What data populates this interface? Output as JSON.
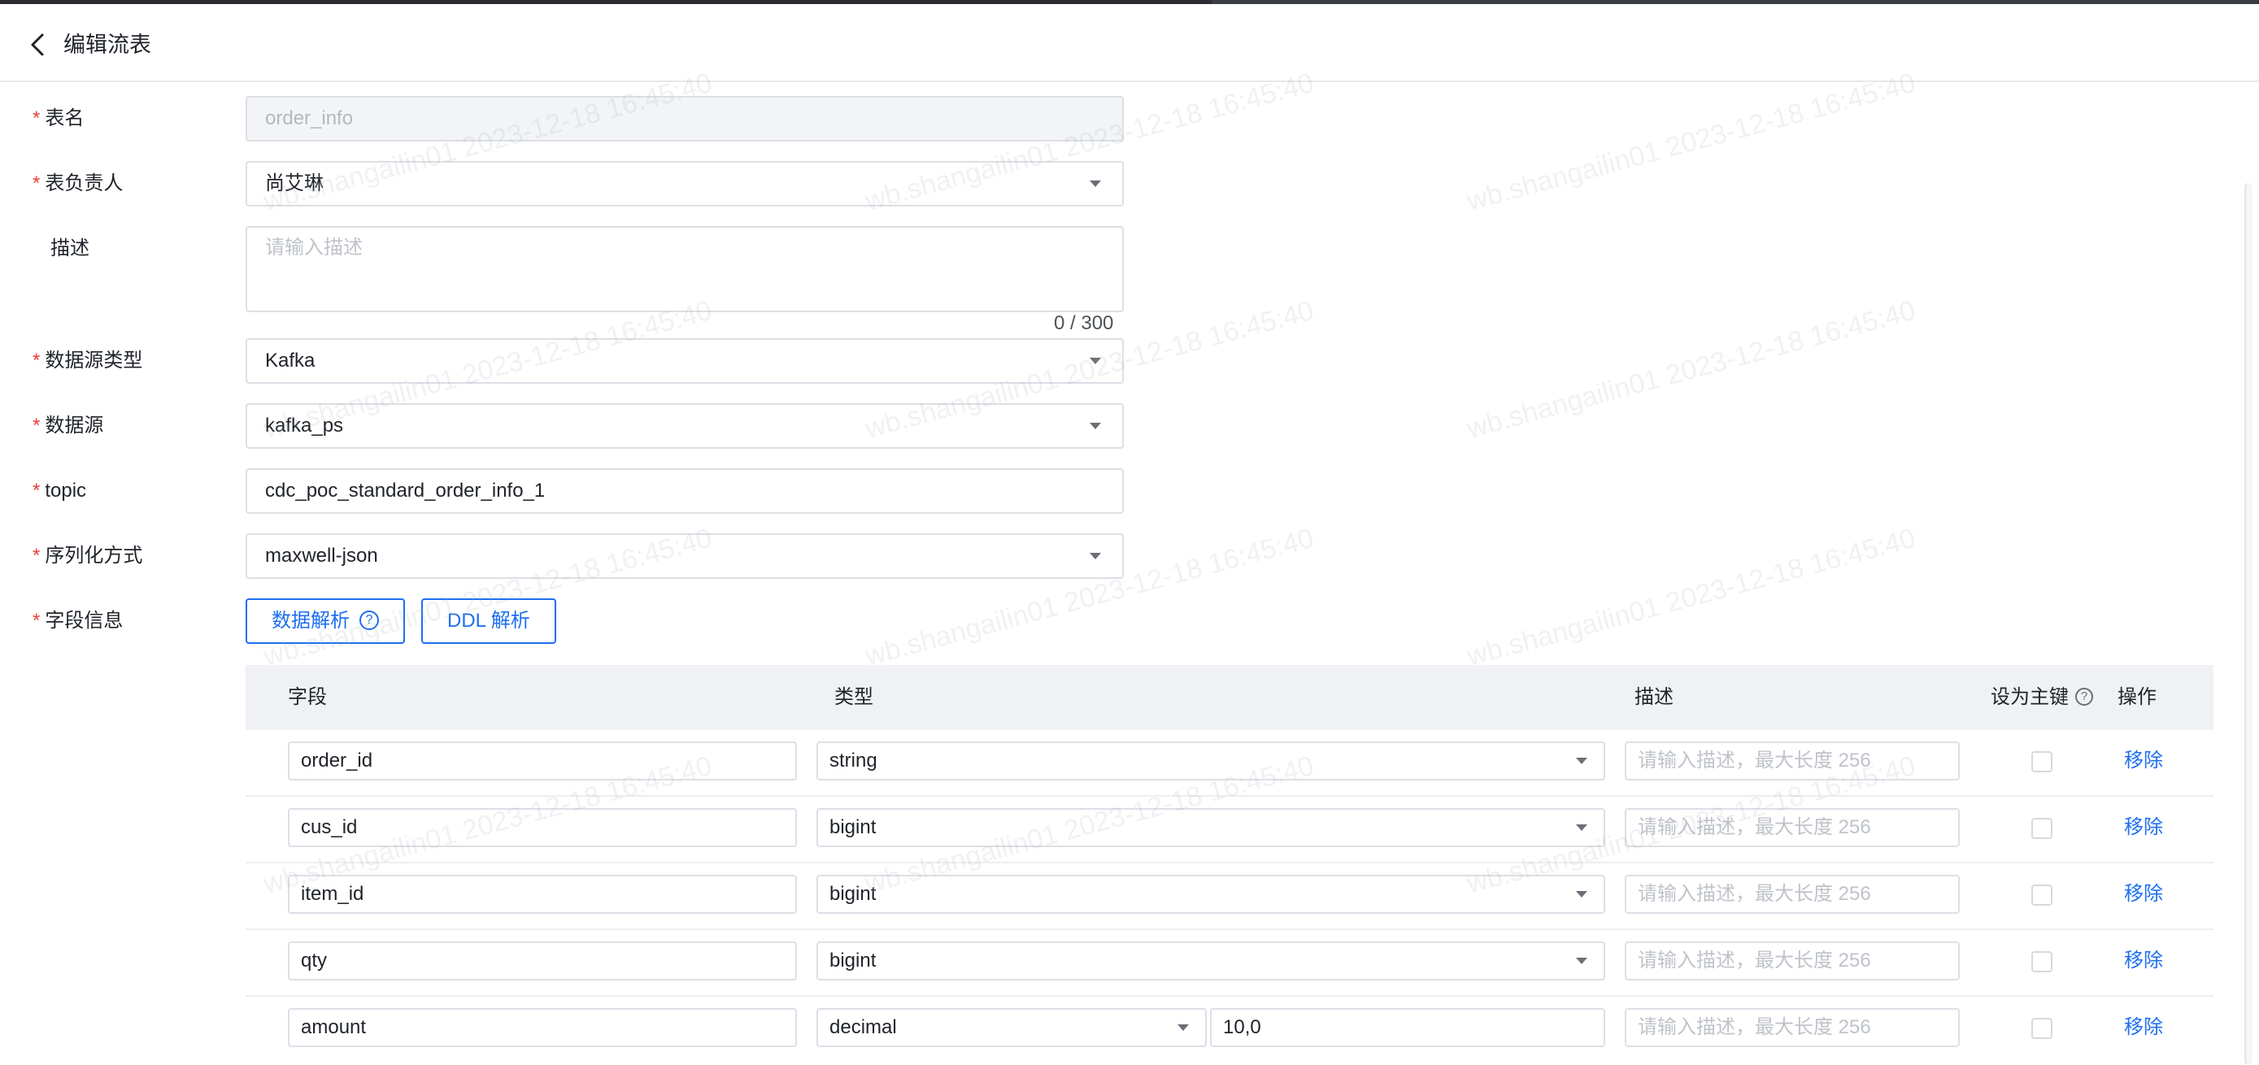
{
  "header": {
    "title": "编辑流表"
  },
  "form": {
    "table_name": {
      "label": "表名",
      "required": true,
      "value": "order_info"
    },
    "owner": {
      "label": "表负责人",
      "required": true,
      "value": "尚艾琳"
    },
    "description": {
      "label": "描述",
      "required": false,
      "placeholder": "请输入描述",
      "counter": "0 / 300"
    },
    "source_type": {
      "label": "数据源类型",
      "required": true,
      "value": "Kafka"
    },
    "source": {
      "label": "数据源",
      "required": true,
      "value": "kafka_ps"
    },
    "topic": {
      "label": "topic",
      "required": true,
      "value": "cdc_poc_standard_order_info_1"
    },
    "serialization": {
      "label": "序列化方式",
      "required": true,
      "value": "maxwell-json"
    },
    "fields_info": {
      "label": "字段信息",
      "required": true
    }
  },
  "required_mark": "*",
  "buttons": {
    "data_parse": "数据解析",
    "ddl_parse": "DDL 解析",
    "help_glyph": "?"
  },
  "table": {
    "headers": {
      "field": "字段",
      "type": "类型",
      "desc": "描述",
      "primary_key": "设为主键",
      "action": "操作"
    },
    "desc_placeholder": "请输入描述，最大长度 256",
    "remove_label": "移除",
    "rows": [
      {
        "field": "order_id",
        "type": "string",
        "extra": null
      },
      {
        "field": "cus_id",
        "type": "bigint",
        "extra": null
      },
      {
        "field": "item_id",
        "type": "bigint",
        "extra": null
      },
      {
        "field": "qty",
        "type": "bigint",
        "extra": null
      },
      {
        "field": "amount",
        "type": "decimal",
        "extra": "10,0"
      }
    ]
  },
  "watermark": {
    "text": "wb.shangailin01 2023-12-18 16:45:40"
  },
  "colors": {
    "accent": "#1d6ff0",
    "required": "#e8413a",
    "header_bg": "#eff1f4"
  }
}
